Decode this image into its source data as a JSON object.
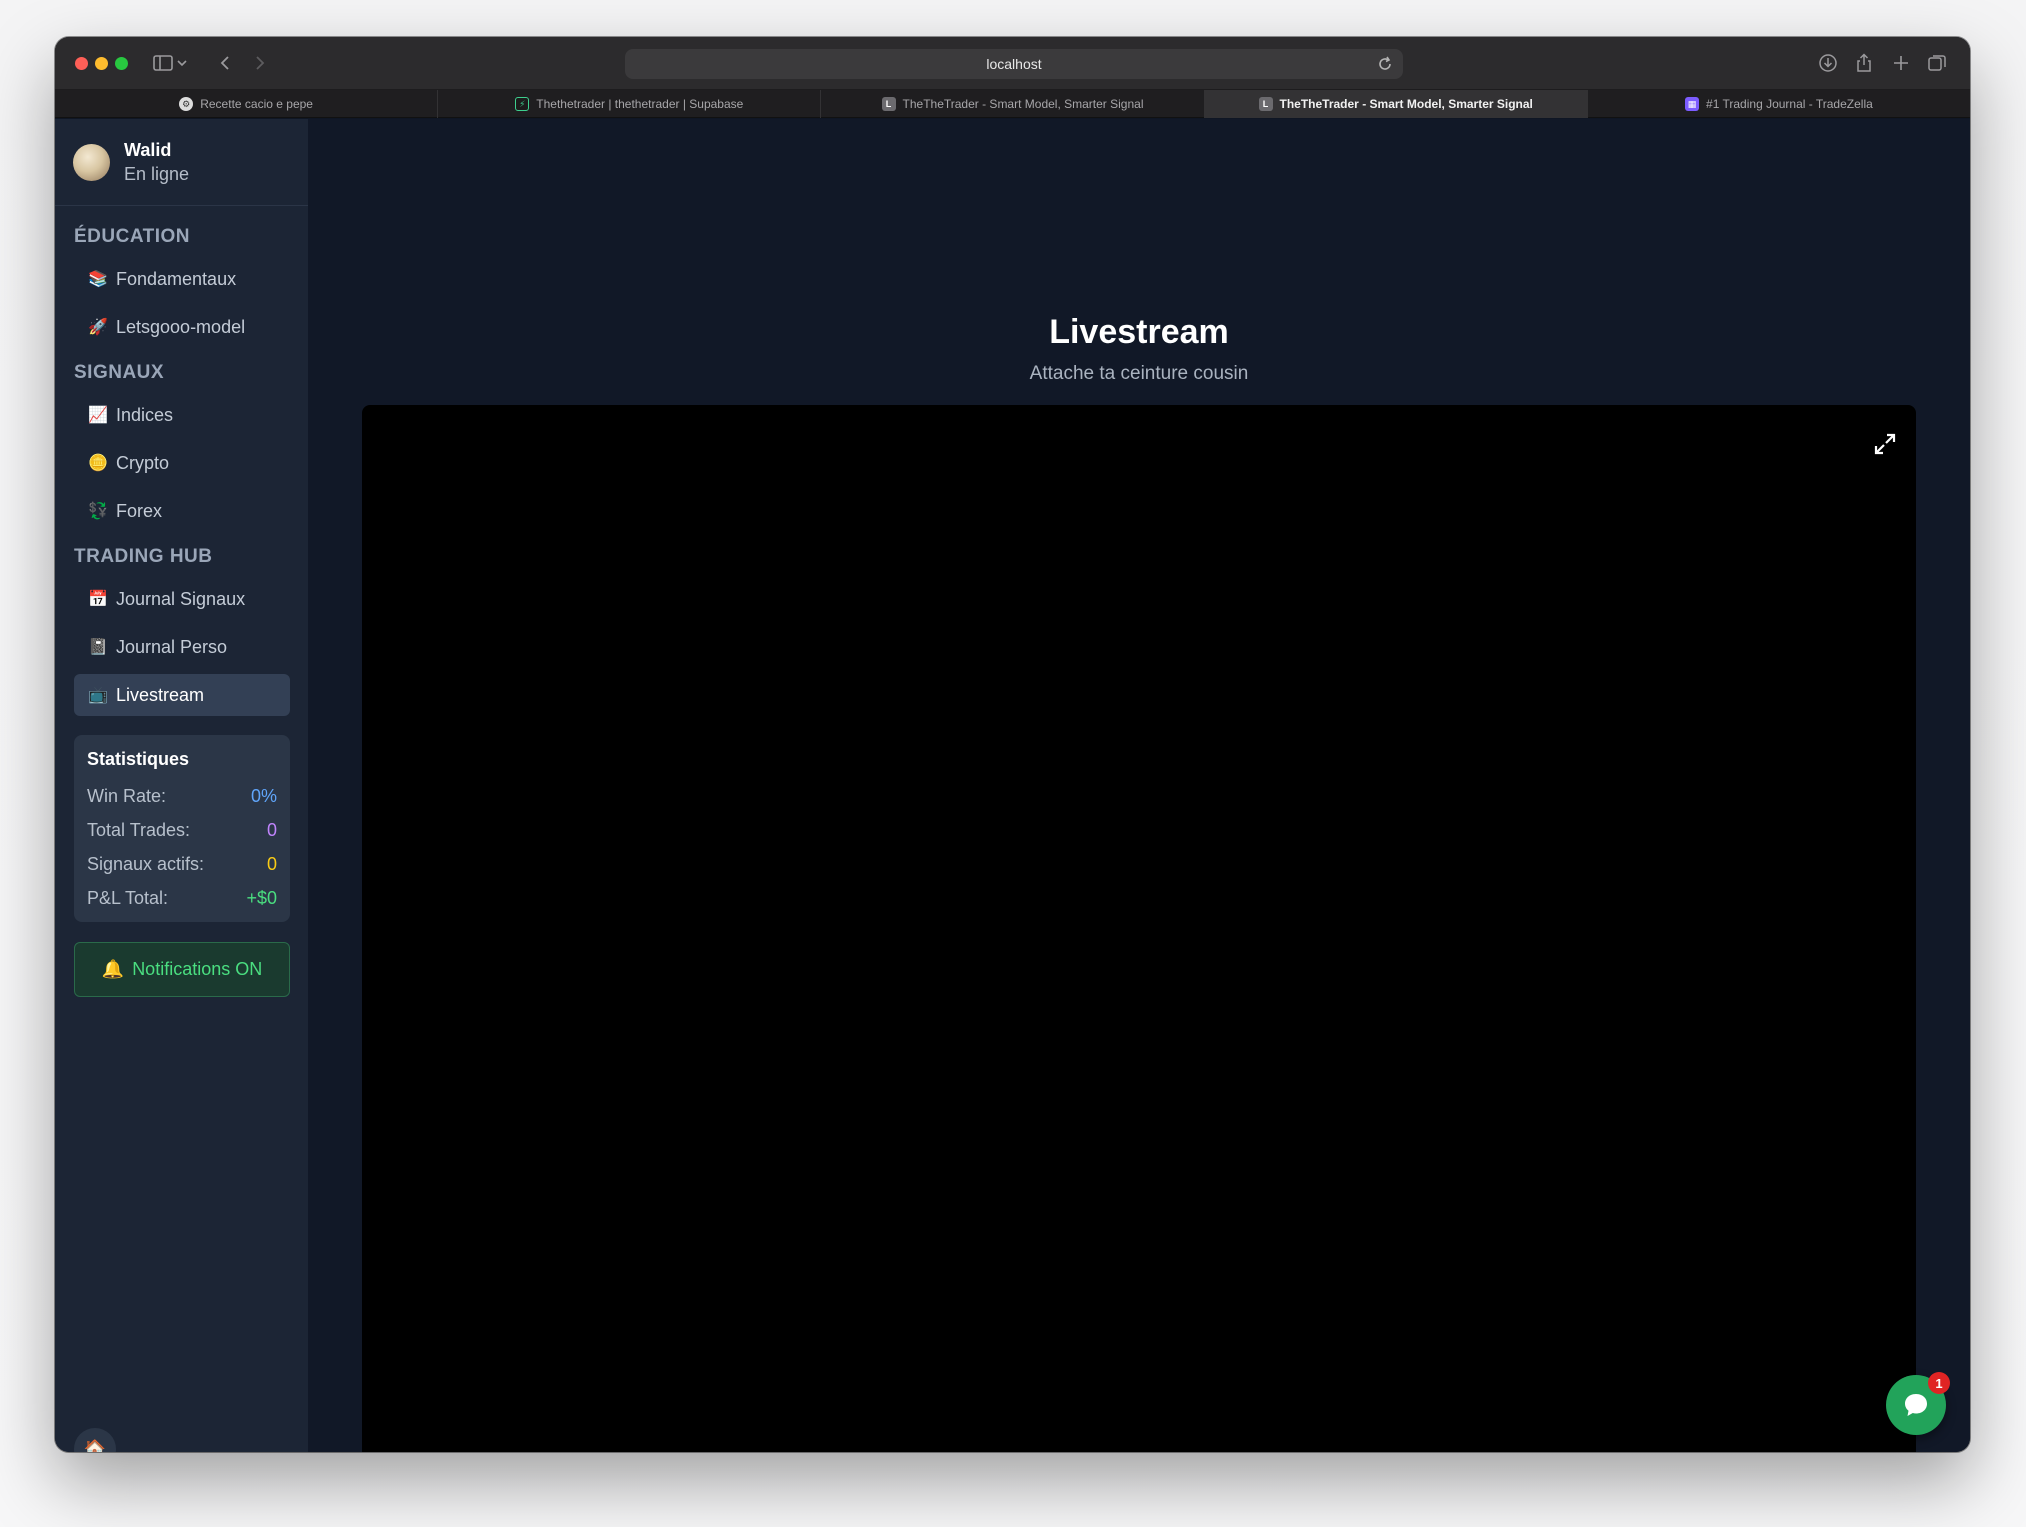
{
  "browser": {
    "url": "localhost",
    "tabs": [
      {
        "label": "Recette cacio e pepe",
        "favicon": "gear-icon",
        "active": false
      },
      {
        "label": "Thethetrader | thethetrader | Supabase",
        "favicon": "supabase-icon",
        "active": false
      },
      {
        "label": "TheTheTrader - Smart Model, Smarter Signal",
        "favicon": "L",
        "active": false
      },
      {
        "label": "TheTheTrader - Smart Model, Smarter Signal",
        "favicon": "L",
        "active": true
      },
      {
        "label": "#1 Trading Journal - TradeZella",
        "favicon": "tradezella-icon",
        "active": false
      }
    ]
  },
  "sidebar": {
    "profile": {
      "name": "Walid",
      "status": "En ligne"
    },
    "sections": [
      {
        "title": "ÉDUCATION",
        "items": [
          {
            "emoji": "📚",
            "label": "Fondamentaux"
          },
          {
            "emoji": "🚀",
            "label": "Letsgooo-model"
          }
        ]
      },
      {
        "title": "SIGNAUX",
        "items": [
          {
            "emoji": "📈",
            "label": "Indices"
          },
          {
            "emoji": "🪙",
            "label": "Crypto"
          },
          {
            "emoji": "💱",
            "label": "Forex"
          }
        ]
      },
      {
        "title": "TRADING HUB",
        "items": [
          {
            "emoji": "📅",
            "label": "Journal Signaux"
          },
          {
            "emoji": "📓",
            "label": "Journal Perso"
          },
          {
            "emoji": "📺",
            "label": "Livestream"
          }
        ]
      }
    ],
    "stats": {
      "title": "Statistiques",
      "rows": [
        {
          "label": "Win Rate:",
          "value": "0%"
        },
        {
          "label": "Total Trades:",
          "value": "0"
        },
        {
          "label": "Signaux actifs:",
          "value": "0"
        },
        {
          "label": "P&L Total:",
          "value": "+$0"
        }
      ]
    },
    "notifications": {
      "emoji": "🔔",
      "label": "Notifications ON"
    },
    "home_emoji": "🏠"
  },
  "main": {
    "title": "Livestream",
    "subtitle": "Attache ta ceinture cousin"
  },
  "chat": {
    "badge": "1"
  },
  "colors": {
    "sidebar_bg": "#1c2535",
    "main_bg": "#111827",
    "accent_green": "#4ade80",
    "win_rate": "#60a5fa",
    "total_trades": "#c084fc",
    "active_signals": "#facc15"
  }
}
